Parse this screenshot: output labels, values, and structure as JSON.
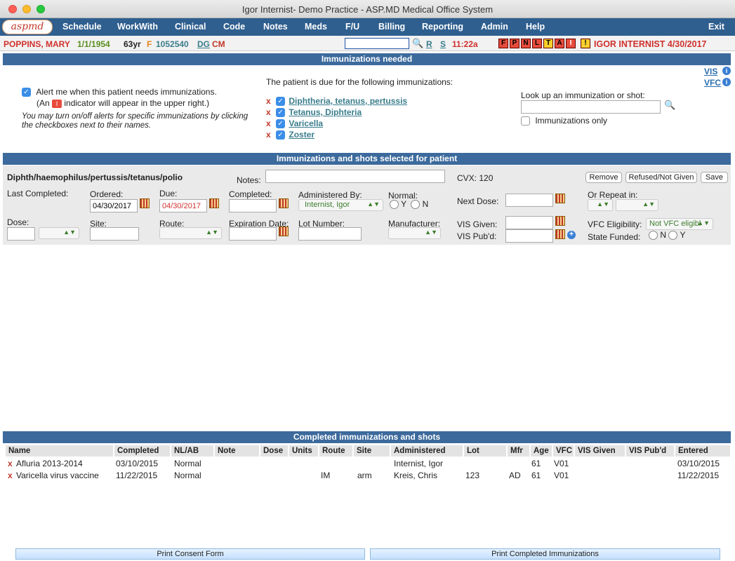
{
  "window": {
    "title": "Igor Internist- Demo Practice - ASP.MD Medical Office System"
  },
  "logo": {
    "text": "aspmd"
  },
  "menu": {
    "items": [
      "Schedule",
      "WorkWith",
      "Clinical",
      "Code",
      "Notes",
      "Meds",
      "F/U",
      "Billing",
      "Reporting",
      "Admin",
      "Help"
    ],
    "exit": "Exit"
  },
  "patient": {
    "name": "POPPINS, MARY",
    "dob": "1/1/1954",
    "age": "63yr",
    "sex": "F",
    "id": "1052540",
    "dg": "DG",
    "cm": "CM",
    "r_link": "R",
    "s_link": "S",
    "time": "11:22a",
    "flags": [
      "F",
      "P",
      "N",
      "L",
      "T",
      "A",
      "I",
      "!"
    ],
    "provider_date": "IGOR INTERNIST 4/30/2017"
  },
  "needed": {
    "header": "Immunizations needed",
    "vis_link": "VIS",
    "vfc_link": "VFC",
    "alert_label": "Alert me when this patient needs immunizations.",
    "indicator_pre": "(An",
    "indicator_badge": "I",
    "indicator_post": "indicator will appear in the upper right.)",
    "note": "You may turn on/off alerts for specific immunizations by clicking the checkboxes next to their names.",
    "due_label": "The patient is due for the following immunizations:",
    "due_items": [
      "Diphtheria, tetanus, pertussis",
      "Tetanus, Diphteria",
      "Varicella",
      "Zoster"
    ],
    "lookup_label": "Look up an immunization or shot:",
    "imm_only_label": "Immunizations only"
  },
  "selected": {
    "header": "Immunizations and shots selected for patient",
    "name": "Diphth/haemophilus/pertussis/tetanus/polio",
    "notes_label": "Notes:",
    "cvx": "CVX: 120",
    "remove": "Remove",
    "refused": "Refused/Not Given",
    "save": "Save",
    "last_completed": "Last Completed:",
    "ordered_label": "Ordered:",
    "ordered_value": "04/30/2017",
    "due_label": "Due:",
    "due_value": "04/30/2017",
    "completed_label": "Completed:",
    "admin_label": "Administered By:",
    "admin_value": "Internist, Igor",
    "normal_label": "Normal:",
    "y": "Y",
    "n": "N",
    "next_dose": "Next Dose:",
    "repeat_label": "Or Repeat in:",
    "dose_label": "Dose:",
    "site_label": "Site:",
    "route_label": "Route:",
    "exp_label": "Expiration Date:",
    "lot_label": "Lot Number:",
    "mfr_label": "Manufacturer:",
    "vis_given": "VIS Given:",
    "vis_pub": "VIS Pub'd:",
    "vfc_label": "VFC Eligibility:",
    "vfc_value": "Not VFC eligibl",
    "state_funded": "State Funded:"
  },
  "completed": {
    "header": "Completed immunizations and shots",
    "columns": [
      "Name",
      "Completed",
      "NL/AB",
      "Note",
      "Dose",
      "Units",
      "Route",
      "Site",
      "Administered",
      "Lot",
      "Mfr",
      "Age",
      "VFC",
      "VIS Given",
      "VIS Pub'd",
      "Entered"
    ],
    "rows": [
      {
        "name": "Afluria 2013-2014",
        "completed": "03/10/2015",
        "nlab": "Normal",
        "route": "",
        "site": "",
        "administered": "Internist, Igor",
        "lot": "",
        "mfr": "",
        "age": "61",
        "vfc": "V01",
        "entered": "03/10/2015"
      },
      {
        "name": "Varicella virus vaccine",
        "completed": "11/22/2015",
        "nlab": "Normal",
        "route": "IM",
        "site": "arm",
        "administered": "Kreis, Chris",
        "lot": "123",
        "mfr": "AD",
        "age": "61",
        "vfc": "V01",
        "entered": "11/22/2015"
      }
    ]
  },
  "footer": {
    "consent": "Print Consent Form",
    "print_completed": "Print Completed Immunizations"
  }
}
